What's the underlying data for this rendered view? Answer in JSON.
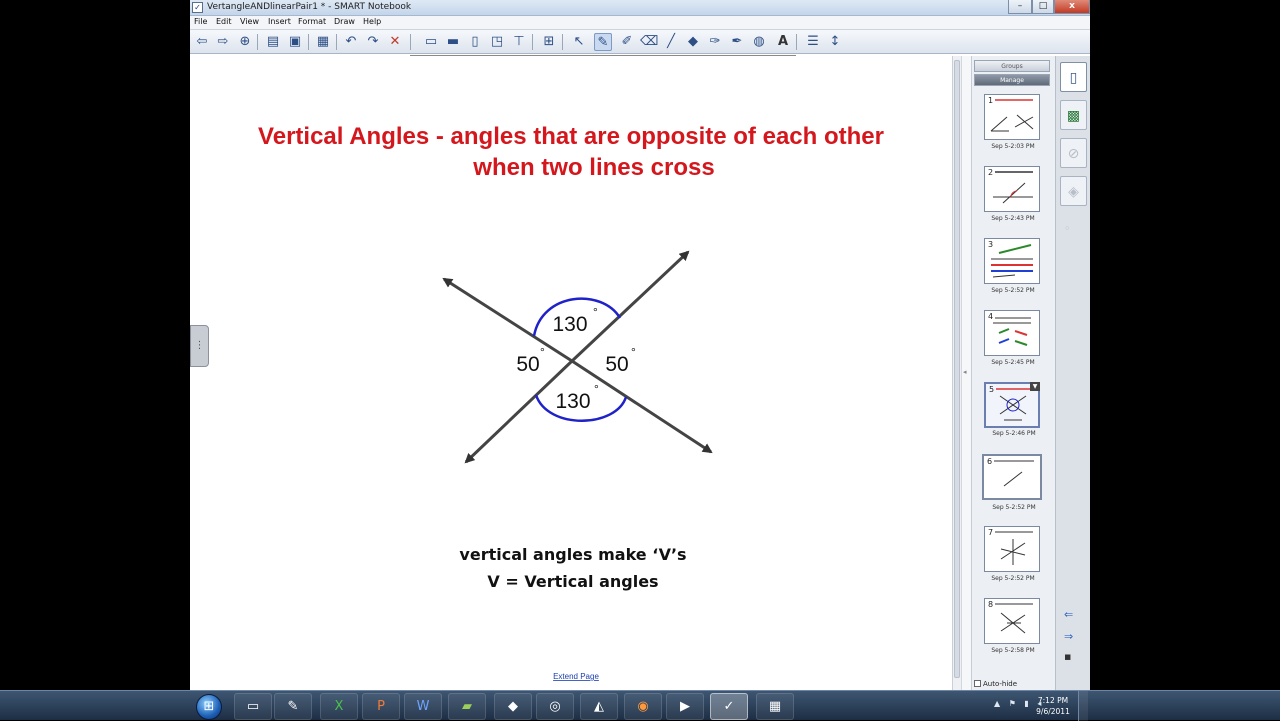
{
  "window": {
    "title": "VertangleANDlinearPair1 * - SMART Notebook",
    "app_icon": "smart-notebook-icon",
    "controls": {
      "minimize": "–",
      "maximize": "□",
      "close": "x"
    }
  },
  "menubar": {
    "items": [
      "File",
      "Edit",
      "View",
      "Insert",
      "Format",
      "Draw",
      "Help"
    ]
  },
  "toolbar": {
    "icons": [
      "back-arrow-icon",
      "forward-arrow-icon",
      "add-page-icon",
      "open-folder-icon",
      "save-icon",
      "paste-icon",
      "undo-icon",
      "redo-icon",
      "delete-icon",
      "screen-shade-icon",
      "full-screen-icon",
      "dual-page-icon",
      "screen-capture-icon",
      "document-camera-icon",
      "table-icon",
      "select-icon",
      "pen-icon",
      "creative-pen-icon",
      "eraser-icon",
      "line-icon",
      "shape-icon",
      "magic-pen-icon",
      "fill-icon",
      "text-icon",
      "properties-icon",
      "move-toolbar-icon"
    ],
    "selected": "pen-icon"
  },
  "pen_styles": {
    "colors": [
      "#2b2b2b",
      "#1f3fd6",
      "#d61f1f",
      "#2a8a2a",
      "#e01ad0",
      "#111111",
      "#d8d61a",
      "#2aa82a"
    ],
    "selected_index": 3
  },
  "slide": {
    "title_line1": "Vertical Angles - angles that are opposite of each other",
    "title_line2": "when two lines cross",
    "angle_top": "130",
    "angle_bottom": "130",
    "angle_left": "50",
    "angle_right": "50",
    "degree": "°",
    "note_line1": "vertical angles make ‘V’s",
    "note_line2": "V = Vertical angles",
    "extend_page": "Extend Page",
    "title_color": "#d4171d",
    "arc_color": "#1e22c8"
  },
  "sorter": {
    "groups_label": "Groups",
    "manage_label": "Manage",
    "slides": [
      {
        "num": "1",
        "time": "Sep 5-2:03 PM"
      },
      {
        "num": "2",
        "time": "Sep 5-2:43 PM"
      },
      {
        "num": "3",
        "time": "Sep 5-2:52 PM"
      },
      {
        "num": "4",
        "time": "Sep 5-2:45 PM"
      },
      {
        "num": "5",
        "time": "Sep 5-2:46 PM"
      },
      {
        "num": "6",
        "time": "Sep 5-2:52 PM"
      },
      {
        "num": "7",
        "time": "Sep 5-2:52 PM"
      },
      {
        "num": "8",
        "time": "Sep 5-2:58 PM"
      }
    ],
    "selected_index": 4,
    "autohide_label": "Auto-hide"
  },
  "side_tabs": {
    "icons": [
      "page-sorter-icon",
      "gallery-icon",
      "attachments-icon",
      "properties-icon"
    ]
  },
  "taskbar": {
    "apps": [
      "explorer-icon",
      "smart-tools-icon",
      "excel-icon",
      "powerpoint-icon",
      "word-icon",
      "notebook-icon",
      "inkscape-icon",
      "chat-icon",
      "recorder-icon",
      "firefox-icon",
      "media-icon",
      "smart-notebook-icon",
      "video-icon"
    ],
    "active_index": 11,
    "tray_icons": "▲ ⚑ ▮ ◂",
    "time": "7:12 PM",
    "date": "9/6/2011"
  }
}
